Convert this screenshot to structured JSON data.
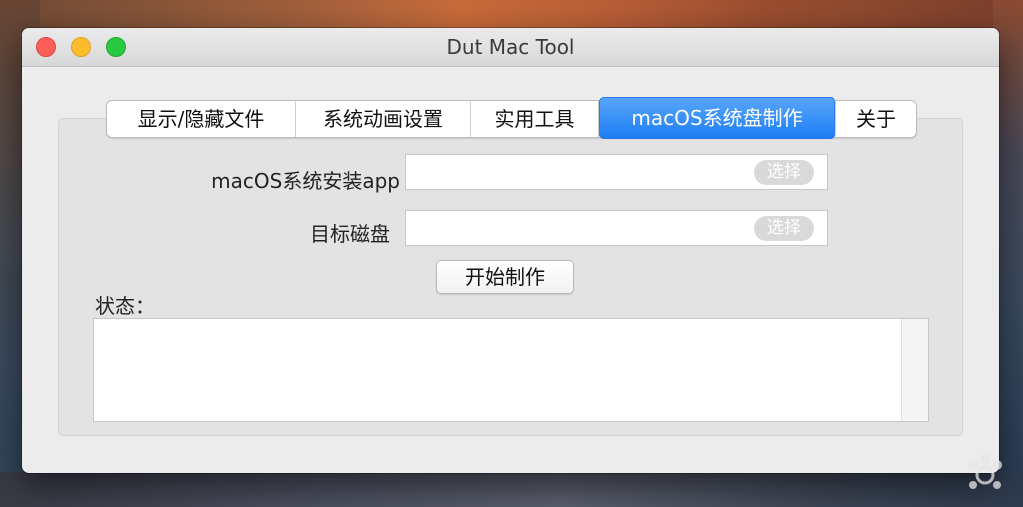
{
  "window": {
    "title": "Dut Mac Tool"
  },
  "tabs": [
    {
      "label": "显示/隐藏文件"
    },
    {
      "label": "系统动画设置"
    },
    {
      "label": "实用工具"
    },
    {
      "label": "macOS系统盘制作"
    },
    {
      "label": "关于"
    }
  ],
  "active_tab_index": 3,
  "form": {
    "installer_label": "macOS系统安装app",
    "installer_value": "",
    "installer_pick": "选择",
    "target_label": "目标磁盘",
    "target_value": "",
    "target_pick": "选择",
    "start_button": "开始制作"
  },
  "status": {
    "label": "状态：",
    "log": ""
  },
  "colors": {
    "accent": "#1c7cf4",
    "close": "#fc5f57",
    "minimize": "#fdbc2e",
    "zoom": "#28c840"
  }
}
